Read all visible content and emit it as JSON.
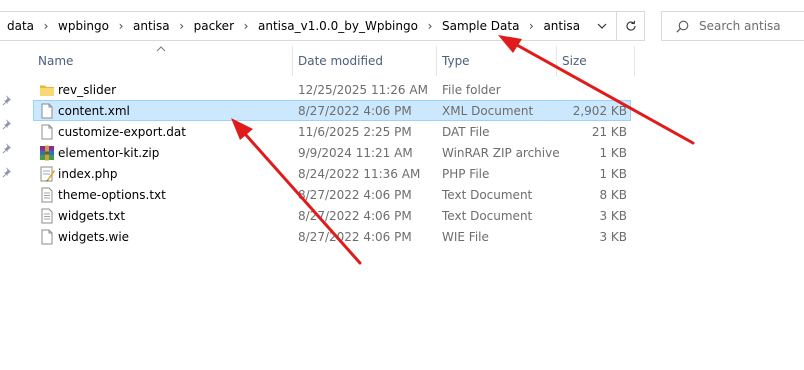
{
  "address_bar": {
    "breadcrumbs": [
      "data",
      "wpbingo",
      "antisa",
      "packer",
      "antisa_v1.0.0_by_Wpbingo",
      "Sample Data",
      "antisa"
    ]
  },
  "search": {
    "placeholder": "Search antisa"
  },
  "columns": {
    "name": "Name",
    "date_modified": "Date modified",
    "type": "Type",
    "size": "Size"
  },
  "files": [
    {
      "name": "rev_slider",
      "date": "12/25/2025 11:26 AM",
      "type": "File folder",
      "size": "",
      "icon": "folder-icon"
    },
    {
      "name": "content.xml",
      "date": "8/27/2022 4:06 PM",
      "type": "XML Document",
      "size": "2,902 KB",
      "icon": "document-icon",
      "selected": true
    },
    {
      "name": "customize-export.dat",
      "date": "11/6/2025 2:25 PM",
      "type": "DAT File",
      "size": "21 KB",
      "icon": "document-icon"
    },
    {
      "name": "elementor-kit.zip",
      "date": "9/9/2024 11:21 AM",
      "type": "WinRAR ZIP archive",
      "size": "1 KB",
      "icon": "winrar-archive-icon"
    },
    {
      "name": "index.php",
      "date": "8/24/2022 11:36 AM",
      "type": "PHP File",
      "size": "1 KB",
      "icon": "php-file-icon"
    },
    {
      "name": "theme-options.txt",
      "date": "8/27/2022 4:06 PM",
      "type": "Text Document",
      "size": "8 KB",
      "icon": "text-file-icon"
    },
    {
      "name": "widgets.txt",
      "date": "8/27/2022 4:06 PM",
      "type": "Text Document",
      "size": "3 KB",
      "icon": "text-file-icon"
    },
    {
      "name": "widgets.wie",
      "date": "8/27/2022 4:06 PM",
      "type": "WIE File",
      "size": "3 KB",
      "icon": "document-icon"
    }
  ],
  "colors": {
    "selection_bg": "#cce8ff",
    "selection_border": "#99d1ff",
    "annotation_arrow": "#e01b1b",
    "header_text": "#4c607a"
  }
}
